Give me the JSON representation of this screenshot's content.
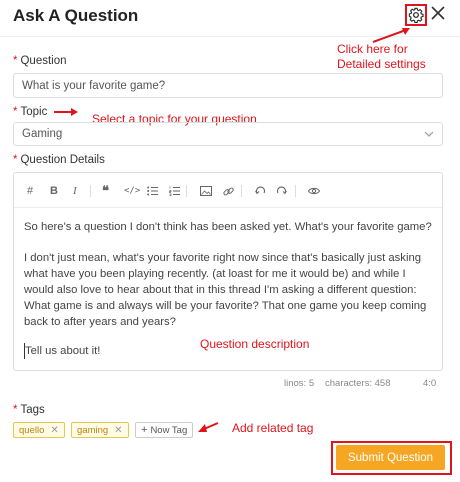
{
  "dialog": {
    "title": "Ask A Question"
  },
  "question": {
    "label": "Question",
    "value": "What is your favorite game?"
  },
  "topic": {
    "label": "Topic",
    "value": "Gaming"
  },
  "details": {
    "label": "Question Details",
    "paragraph1": "So here's a question I don't think has been asked yet. What's your favorite game?",
    "paragraph2": "I don't just mean, what's your favorite right now since that's basically just asking what have you been playing recently. (at loast for me it would be) and while I would also love to hear about that in this thread I'm asking a different question: What game is and always will be your favorite? That one game you keep coming back to after years and years?",
    "paragraph3": "Tell us about it!",
    "lines": "linos: 5",
    "characters": "characters: 458",
    "cursor": "4:0"
  },
  "tags": {
    "label": "Tags",
    "items": [
      "quello",
      "gaming"
    ],
    "new_tag_label": "Now Tag"
  },
  "submit_label": "Submit Question",
  "annotations": {
    "settings_line1": "Click here for",
    "settings_line2": "Detailed settings",
    "topic": "Select a topic for your question",
    "description": "Question description",
    "tag": "Add related tag"
  },
  "colors": {
    "accent": "#f5a623",
    "annotation_red": "#e0151b",
    "tag_yellow": "#e6c84c"
  },
  "icons": [
    "gear-icon",
    "close-icon",
    "chevron-down-icon",
    "heading-icon",
    "bold-icon",
    "italic-icon",
    "quote-icon",
    "code-icon",
    "bullet-list-icon",
    "numbered-list-icon",
    "image-icon",
    "link-icon",
    "undo-icon",
    "redo-icon",
    "preview-icon",
    "plus-icon"
  ]
}
